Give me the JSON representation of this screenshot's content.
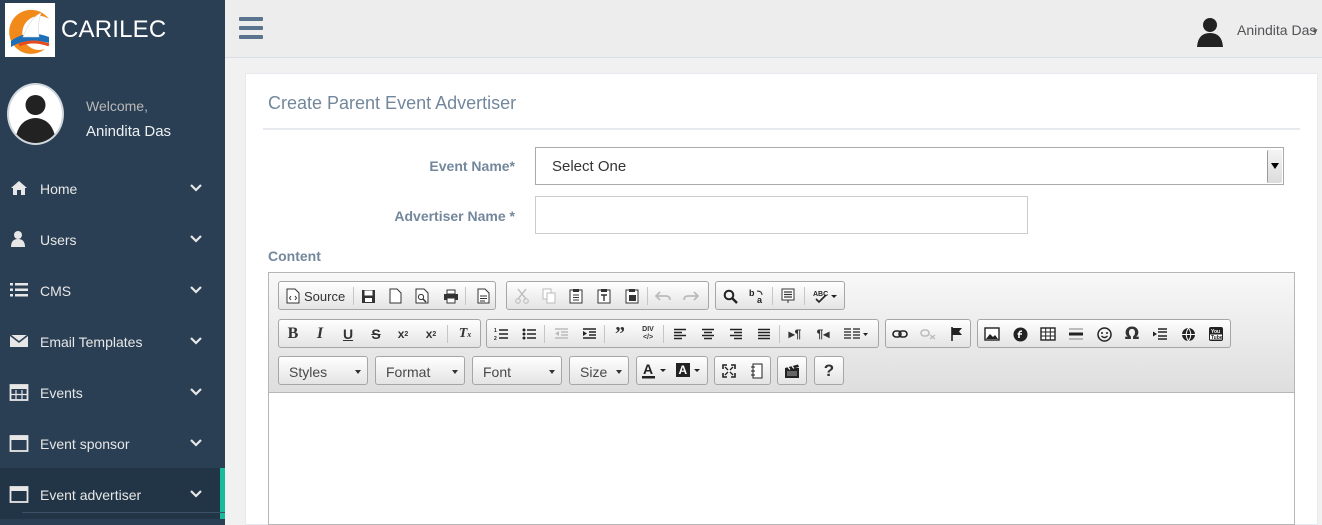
{
  "brand": {
    "name": "CARILEC",
    "logo_icon": "carilec-logo"
  },
  "profile": {
    "welcome": "Welcome,",
    "name": "Anindita Das"
  },
  "menu": [
    {
      "label": "Home",
      "icon": "home-icon"
    },
    {
      "label": "Users",
      "icon": "user-icon"
    },
    {
      "label": "CMS",
      "icon": "list-icon"
    },
    {
      "label": "Email Templates",
      "icon": "envelope-icon"
    },
    {
      "label": "Events",
      "icon": "calendar-icon"
    },
    {
      "label": "Event sponsor",
      "icon": "calendar-icon"
    },
    {
      "label": "Event advertiser",
      "icon": "calendar-icon",
      "active": true
    }
  ],
  "topnav": {
    "user_name": "Anindita Das"
  },
  "page": {
    "title": "Create Parent Event Advertiser",
    "event_name_label": "Event Name*",
    "event_name_value": "Select One",
    "advertiser_name_label": "Advertiser Name *",
    "advertiser_name_value": "",
    "content_label": "Content"
  },
  "editor": {
    "source_label": "Source",
    "combos": {
      "styles": "Styles",
      "format": "Format",
      "font": "Font",
      "size": "Size"
    }
  },
  "colors": {
    "sidebar": "#2a3f54",
    "accent": "#1abb9c",
    "text_muted": "#73879c"
  }
}
